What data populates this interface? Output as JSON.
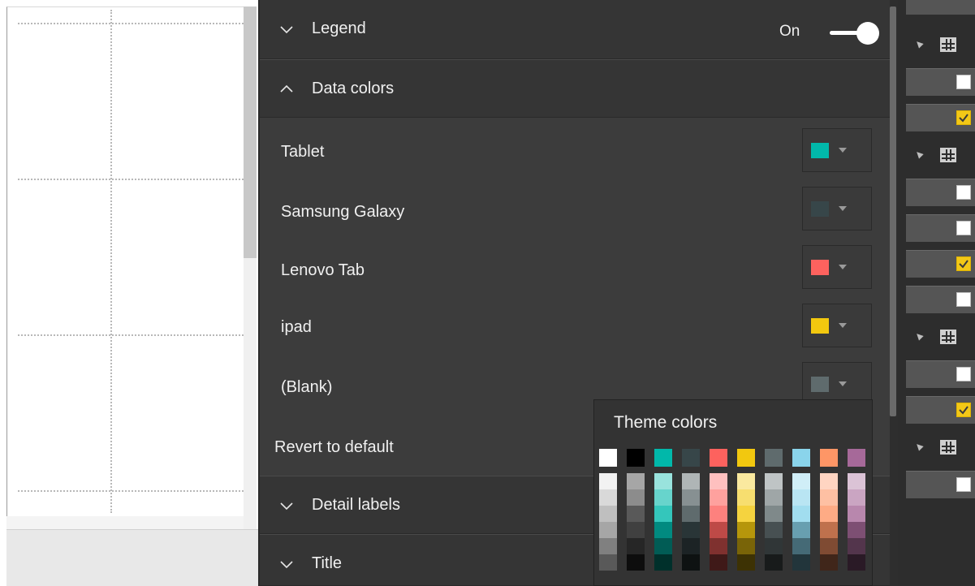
{
  "format_panel": {
    "legend": {
      "label": "Legend",
      "toggle_label": "On",
      "toggle_on": true,
      "expanded": false
    },
    "data_colors": {
      "label": "Data colors",
      "expanded": true,
      "items": [
        {
          "label": "Tablet",
          "color": "#01B8AA"
        },
        {
          "label": "Samsung Galaxy",
          "color": "#374649"
        },
        {
          "label": "Lenovo Tab",
          "color": "#FD625E"
        },
        {
          "label": "ipad",
          "color": "#F2C80F"
        },
        {
          "label": "(Blank)",
          "color": "#5F6B6D"
        }
      ],
      "revert_label": "Revert to default"
    },
    "detail_labels": {
      "label": "Detail labels",
      "expanded": false
    },
    "title": {
      "label": "Title",
      "expanded": false
    }
  },
  "theme_popup": {
    "title": "Theme colors",
    "columns": [
      {
        "top": "#FFFFFF",
        "shades": [
          "#F2F2F2",
          "#D9D9D9",
          "#BFBFBF",
          "#A6A6A6",
          "#808080",
          "#595959"
        ]
      },
      {
        "top": "#000000",
        "shades": [
          "#A6A6A6",
          "#8C8C8C",
          "#595959",
          "#404040",
          "#262626",
          "#0D0D0D"
        ]
      },
      {
        "top": "#01B8AA",
        "shades": [
          "#99E3DD",
          "#67D4CC",
          "#34C6BB",
          "#018A80",
          "#015C55",
          "#00302B"
        ]
      },
      {
        "top": "#374649",
        "shades": [
          "#AFB5B6",
          "#879092",
          "#5F6B6D",
          "#293537",
          "#1C2325",
          "#0E1212"
        ]
      },
      {
        "top": "#FD625E",
        "shades": [
          "#FEC0BF",
          "#FEA19E",
          "#FD817E",
          "#BE4A47",
          "#7F312F",
          "#3F1918"
        ]
      },
      {
        "top": "#F2C80F",
        "shades": [
          "#FAE99F",
          "#F7DE6F",
          "#F5D33F",
          "#B6960B",
          "#796408",
          "#3D3204"
        ]
      },
      {
        "top": "#5F6B6D",
        "shades": [
          "#BFC4C5",
          "#9FA6A7",
          "#7F898A",
          "#475052",
          "#303637",
          "#181B1B"
        ]
      },
      {
        "top": "#8AD4EB",
        "shades": [
          "#D0EEF7",
          "#B9E5F3",
          "#A1DDEF",
          "#689FB0",
          "#456A76",
          "#22353B"
        ]
      },
      {
        "top": "#FE9666",
        "shades": [
          "#FFD5C2",
          "#FEC0A3",
          "#FEAB85",
          "#BF714D",
          "#7F4B33",
          "#40261A"
        ]
      },
      {
        "top": "#A66999",
        "shades": [
          "#DBC3D6",
          "#CAA5C2",
          "#B887AD",
          "#7D4F73",
          "#53354C",
          "#2A1A26"
        ]
      }
    ]
  },
  "fields_panel": {
    "rows": [
      {
        "kind": "strip"
      },
      {
        "kind": "table"
      },
      {
        "kind": "field",
        "checked": false
      },
      {
        "kind": "field",
        "checked": true
      },
      {
        "kind": "table"
      },
      {
        "kind": "field",
        "checked": false
      },
      {
        "kind": "field",
        "checked": false
      },
      {
        "kind": "field",
        "checked": true
      },
      {
        "kind": "field",
        "checked": false
      },
      {
        "kind": "table"
      },
      {
        "kind": "field",
        "checked": false
      },
      {
        "kind": "field",
        "checked": true
      },
      {
        "kind": "table"
      },
      {
        "kind": "field",
        "checked": false
      }
    ]
  }
}
